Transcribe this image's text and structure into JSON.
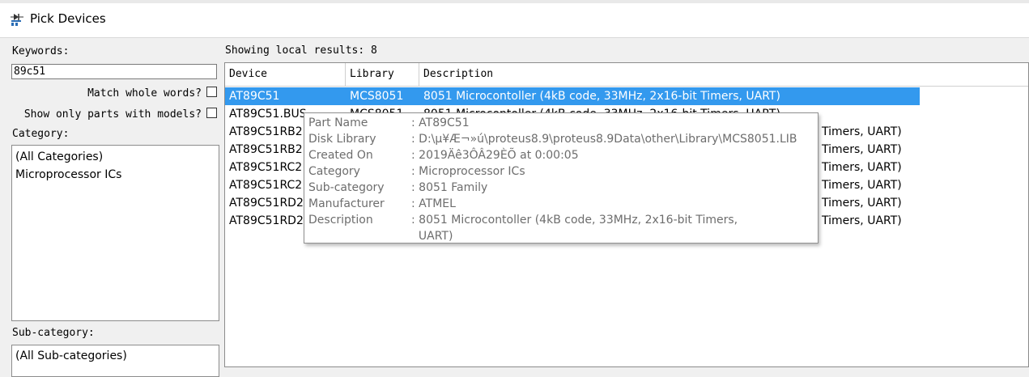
{
  "window": {
    "title": "Pick Devices",
    "icon": "device-pick-icon"
  },
  "left": {
    "keywords_label": "Keywords:",
    "keywords_value": "89c51",
    "match_whole_words_label": "Match whole words?",
    "match_whole_words_checked": false,
    "show_only_models_label": "Show only parts with models?",
    "show_only_models_checked": false,
    "category_label": "Category:",
    "categories": [
      "(All Categories)",
      "Microprocessor ICs"
    ],
    "subcategory_label": "Sub-category:",
    "subcategories": [
      "(All Sub-categories)"
    ]
  },
  "results": {
    "label": "Showing local results: 8",
    "columns": [
      "Device",
      "Library",
      "Description"
    ],
    "rows": [
      {
        "device": "AT89C51",
        "library": "MCS8051",
        "description": "8051 Microcontoller (4kB code, 33MHz, 2x16-bit Timers, UART)",
        "selected": true
      },
      {
        "device": "AT89C51.BUS",
        "library": "MCS8051",
        "description": "8051 Microcontoller (4kB code, 33MHz, 2x16-bit Timers, UART)"
      },
      {
        "device": "AT89C51RB2",
        "tail": "Timers, UART)"
      },
      {
        "device": "AT89C51RB2",
        "tail": "Timers, UART)"
      },
      {
        "device": "AT89C51RC2",
        "tail": "Timers, UART)"
      },
      {
        "device": "AT89C51RC2",
        "tail": "Timers, UART)"
      },
      {
        "device": "AT89C51RD2",
        "tail": "Timers, UART)"
      },
      {
        "device": "AT89C51RD2",
        "tail": "Timers, UART)"
      }
    ]
  },
  "tooltip": {
    "rows": [
      {
        "key": "Part Name",
        "value": ": AT89C51"
      },
      {
        "key": "Disk Library",
        "value": ": D:\\µ¥Æ¬»ú\\proteus8.9\\proteus8.9Data\\other\\Library\\MCS8051.LIB"
      },
      {
        "key": "Created On",
        "value": ": 2019Äê3ÔÂ29ÈÕ at 0:00:05"
      },
      {
        "key": "Category",
        "value": ": Microprocessor ICs"
      },
      {
        "key": "Sub-category",
        "value": ": 8051 Family"
      },
      {
        "key": "Manufacturer",
        "value": ": ATMEL"
      },
      {
        "key": "Description",
        "value": ": 8051 Microcontoller (4kB code, 33MHz, 2x16-bit Timers,"
      },
      {
        "key": "",
        "value": "  UART)"
      }
    ]
  },
  "colors": {
    "selection": "#3399ee",
    "tooltip_text": "#6d6d6d"
  }
}
